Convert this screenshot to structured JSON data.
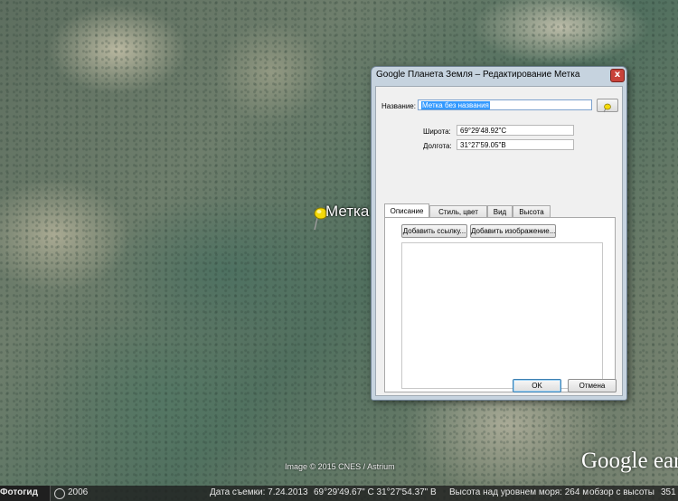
{
  "map": {
    "placemark_label": "Метка",
    "imagery_credit": "Image © 2015 CNES / Astrium",
    "logo_text": "Google earth"
  },
  "statusbar": {
    "history_button": "Фотогид",
    "year": "2006",
    "imagery_date": "Дата съемки: 7.24.2013",
    "coordinates": "69°29'49.67\" С  31°27'54.37\" В",
    "elevation": "Высота над уровнем моря:   264 м",
    "eye_alt": "обзор с высоты",
    "eye_alt_value": "351"
  },
  "dialog": {
    "title": "Google Планета Земля – Редактирование Метка",
    "close_label": "x",
    "name_label": "Название:",
    "name_value": "Метка без названия",
    "latitude_label": "Широта:",
    "latitude_value": "69°29'48.92\"С",
    "longitude_label": "Долгота:",
    "longitude_value": "31°27'59.05\"В",
    "tabs": [
      {
        "label": "Описание"
      },
      {
        "label": "Стиль, цвет"
      },
      {
        "label": "Вид"
      },
      {
        "label": "Высота"
      }
    ],
    "add_link_button": "Добавить ссылку...",
    "add_image_button": "Добавить изображение...",
    "description_value": "",
    "ok_button": "OK",
    "cancel_button": "Отмена"
  },
  "colors": {
    "selection": "#3399ff",
    "dialog_frame": "#c6d3df",
    "close_button": "#c8423a",
    "pin": "#f5d90a"
  }
}
